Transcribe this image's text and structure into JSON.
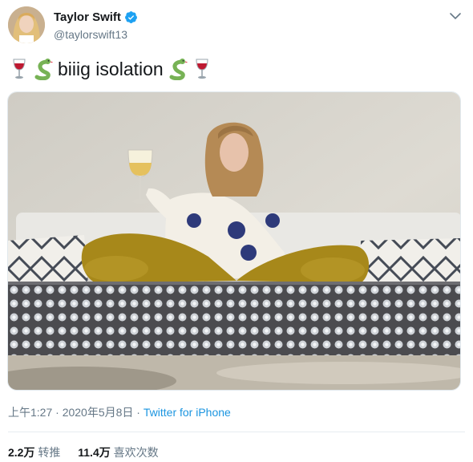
{
  "author": {
    "name": "Taylor Swift",
    "handle": "@taylorswift13",
    "verified": true
  },
  "tweet": {
    "text": "biiig isolation",
    "emojis_left": [
      "wine-glass",
      "snake"
    ],
    "emojis_right": [
      "snake",
      "wine-glass"
    ]
  },
  "meta": {
    "time": "上午1:27",
    "separator": " · ",
    "date": "2020年5月8日",
    "source": "Twitter for iPhone"
  },
  "stats": {
    "retweets_count": "2.2万",
    "retweets_label": "转推",
    "likes_count": "11.4万",
    "likes_label": "喜欢次数"
  },
  "colors": {
    "link": "#1b95e0",
    "secondary": "#657786",
    "verified": "#1da1f2"
  }
}
